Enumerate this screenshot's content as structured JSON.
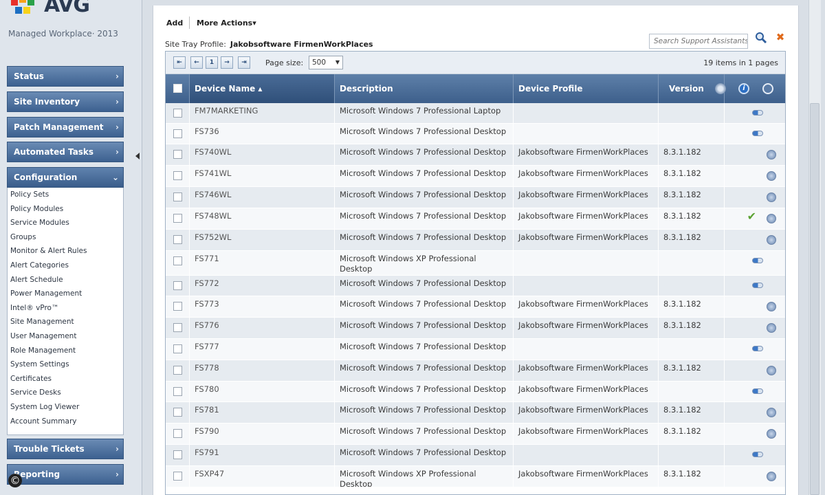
{
  "brand": {
    "logo": "AVG",
    "product": "Managed Workplace· 2013"
  },
  "nav": {
    "status": "Status",
    "site_inventory": "Site Inventory",
    "patch_management": "Patch Management",
    "automated_tasks": "Automated Tasks",
    "configuration": "Configuration",
    "trouble_tickets": "Trouble Tickets",
    "reporting": "Reporting",
    "config_items": [
      "Policy Sets",
      "Policy Modules",
      "Service Modules",
      "Groups",
      "Monitor & Alert Rules",
      "Alert Categories",
      "Alert Schedule",
      "Power Management",
      "Intel® vPro™",
      "Site Management",
      "User Management",
      "Role Management",
      "System Settings",
      "Certificates",
      "Service Desks",
      "System Log Viewer",
      "Account Summary"
    ]
  },
  "copyright": "©",
  "toolbar": {
    "add": "Add",
    "more_actions": "More Actions▾",
    "profile_label": "Site Tray Profile:",
    "profile_value": "Jakobsoftware FirmenWorkPlaces",
    "search_placeholder": "Search Support Assistants"
  },
  "pager": {
    "first": "⇤",
    "prev": "←",
    "page": "1",
    "next": "→",
    "last": "⇥",
    "page_size_label": "Page size:",
    "page_size": "500",
    "items_info": "19 items in 1 pages"
  },
  "columns": {
    "device_name": "Device Name ▴",
    "description": "Description",
    "device_profile": "Device Profile",
    "version": "Version"
  },
  "rows": [
    {
      "name": "FM7MARKETING",
      "desc": "Microsoft Windows 7 Professional Laptop",
      "profile": "",
      "version": "",
      "status": "bar"
    },
    {
      "name": "FS736",
      "desc": "Microsoft Windows 7 Professional Desktop",
      "profile": "",
      "version": "",
      "status": "bar"
    },
    {
      "name": "FS740WL",
      "desc": "Microsoft Windows 7 Professional Desktop",
      "profile": "Jakobsoftware FirmenWorkPlaces",
      "version": "8.3.1.182",
      "status": "clock"
    },
    {
      "name": "FS741WL",
      "desc": "Microsoft Windows 7 Professional Desktop",
      "profile": "Jakobsoftware FirmenWorkPlaces",
      "version": "8.3.1.182",
      "status": "clock"
    },
    {
      "name": "FS746WL",
      "desc": "Microsoft Windows 7 Professional Desktop",
      "profile": "Jakobsoftware FirmenWorkPlaces",
      "version": "8.3.1.182",
      "status": "clock"
    },
    {
      "name": "FS748WL",
      "desc": "Microsoft Windows 7 Professional Desktop",
      "profile": "Jakobsoftware FirmenWorkPlaces",
      "version": "8.3.1.182",
      "status": "check-clock"
    },
    {
      "name": "FS752WL",
      "desc": "Microsoft Windows 7 Professional Desktop",
      "profile": "Jakobsoftware FirmenWorkPlaces",
      "version": "8.3.1.182",
      "status": "clock"
    },
    {
      "name": "FS771",
      "desc": "Microsoft Windows XP Professional Desktop",
      "profile": "",
      "version": "",
      "status": "bar"
    },
    {
      "name": "FS772",
      "desc": "Microsoft Windows 7 Professional Desktop",
      "profile": "",
      "version": "",
      "status": "bar"
    },
    {
      "name": "FS773",
      "desc": "Microsoft Windows 7 Professional Desktop",
      "profile": "Jakobsoftware FirmenWorkPlaces",
      "version": "8.3.1.182",
      "status": "clock"
    },
    {
      "name": "FS776",
      "desc": "Microsoft Windows 7 Professional Desktop",
      "profile": "Jakobsoftware FirmenWorkPlaces",
      "version": "8.3.1.182",
      "status": "clock"
    },
    {
      "name": "FS777",
      "desc": "Microsoft Windows 7 Professional Desktop",
      "profile": "",
      "version": "",
      "status": "bar"
    },
    {
      "name": "FS778",
      "desc": "Microsoft Windows 7 Professional Desktop",
      "profile": "Jakobsoftware FirmenWorkPlaces",
      "version": "8.3.1.182",
      "status": "clock"
    },
    {
      "name": "FS780",
      "desc": "Microsoft Windows 7 Professional Desktop",
      "profile": "Jakobsoftware FirmenWorkPlaces",
      "version": "",
      "status": "bar"
    },
    {
      "name": "FS781",
      "desc": "Microsoft Windows 7 Professional Desktop",
      "profile": "Jakobsoftware FirmenWorkPlaces",
      "version": "8.3.1.182",
      "status": "clock"
    },
    {
      "name": "FS790",
      "desc": "Microsoft Windows 7 Professional Desktop",
      "profile": "Jakobsoftware FirmenWorkPlaces",
      "version": "8.3.1.182",
      "status": "clock"
    },
    {
      "name": "FS791",
      "desc": "Microsoft Windows 7 Professional Desktop",
      "profile": "",
      "version": "",
      "status": "bar"
    },
    {
      "name": "FSXP47",
      "desc": "Microsoft Windows XP Professional Desktop",
      "profile": "Jakobsoftware FirmenWorkPlaces",
      "version": "8.3.1.182",
      "status": "clock"
    }
  ]
}
